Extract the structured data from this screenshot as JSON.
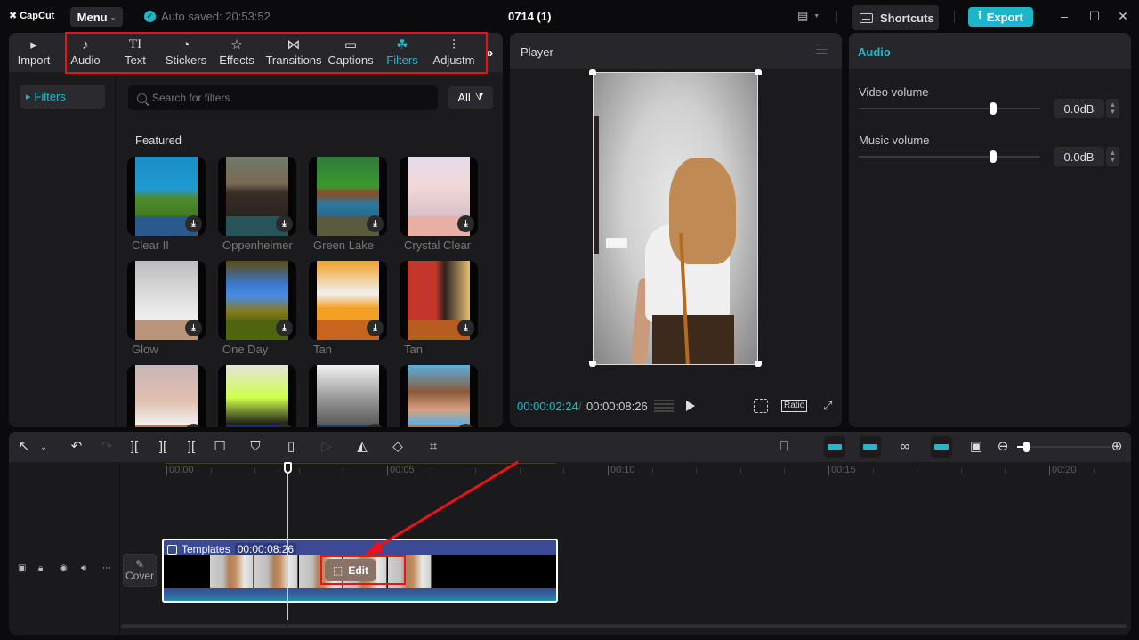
{
  "app": {
    "logo": "CapCut",
    "menu_label": "Menu",
    "autosave": "Auto saved: 20:53:52",
    "project_title": "0714 (1)",
    "shortcuts_label": "Shortcuts",
    "export_label": "Export",
    "accent_color": "#1fb5c9"
  },
  "toolbar": {
    "tools": [
      {
        "label": "Import",
        "icon": "import-icon"
      },
      {
        "label": "Audio",
        "icon": "audio-icon"
      },
      {
        "label": "Text",
        "icon": "text-icon"
      },
      {
        "label": "Stickers",
        "icon": "stickers-icon"
      },
      {
        "label": "Effects",
        "icon": "effects-icon"
      },
      {
        "label": "Transitions",
        "icon": "transitions-icon"
      },
      {
        "label": "Captions",
        "icon": "captions-icon"
      },
      {
        "label": "Filters",
        "icon": "filters-icon",
        "active": true
      },
      {
        "label": "Adjustm",
        "icon": "adjustment-icon"
      }
    ]
  },
  "media": {
    "sidebar_item": "Filters",
    "search_placeholder": "Search for filters",
    "filter_dropdown": "All",
    "section": "Featured",
    "filters": [
      {
        "name": "Clear II"
      },
      {
        "name": "Oppenheimer"
      },
      {
        "name": "Green Lake"
      },
      {
        "name": "Crystal Clear"
      },
      {
        "name": "Glow"
      },
      {
        "name": "One Day"
      },
      {
        "name": "Tan"
      },
      {
        "name": "Tan"
      },
      {
        "name": ""
      },
      {
        "name": ""
      },
      {
        "name": ""
      },
      {
        "name": ""
      }
    ]
  },
  "player": {
    "title": "Player",
    "current_time": "00:00:02:24",
    "total_time": "00:00:08:26",
    "ratio_label": "Ratio"
  },
  "properties": {
    "tab": "Audio",
    "video_volume_label": "Video volume",
    "video_volume_value": "0.0dB",
    "video_volume_fraction": 0.74,
    "music_volume_label": "Music volume",
    "music_volume_value": "0.0dB",
    "music_volume_fraction": 0.74
  },
  "timeline": {
    "ruler_labels": [
      "00:00",
      "00:05",
      "00:10",
      "00:15",
      "00:20"
    ],
    "cover_label": "Cover",
    "clip_name": "Templates",
    "clip_duration": "00:00:08:26",
    "edit_label": "Edit"
  }
}
